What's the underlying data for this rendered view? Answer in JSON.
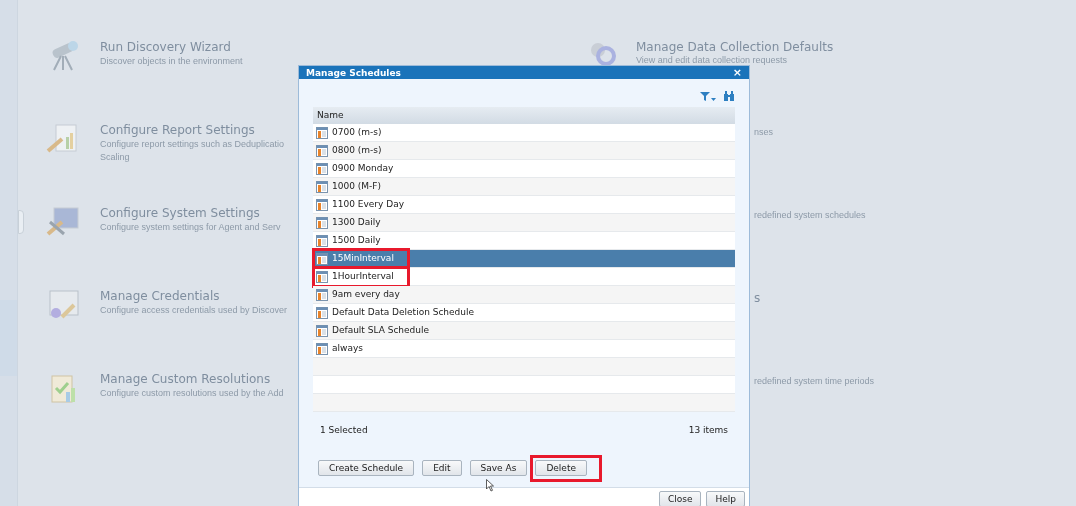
{
  "background": {
    "left_items": [
      {
        "title": "Run Discovery Wizard",
        "lines": [
          "Discover objects in the environment"
        ]
      },
      {
        "title": "Configure Report Settings",
        "lines": [
          "Configure report settings such as Deduplicatio",
          "Scaling"
        ]
      },
      {
        "title": "Configure System Settings",
        "lines": [
          "Configure system settings for Agent and Serv"
        ]
      },
      {
        "title": "Manage Credentials",
        "lines": [
          "Configure access credentials used by Discover"
        ]
      },
      {
        "title": "Manage Custom Resolutions",
        "lines": [
          "Configure custom resolutions used by the Add"
        ]
      }
    ],
    "right_item": {
      "title": "Manage Data Collection Defaults",
      "description": "View and edit data collection requests"
    },
    "right_fragments": [
      {
        "kind": "description",
        "text": "nses"
      },
      {
        "kind": "description",
        "text": "redefined system schedules"
      },
      {
        "kind": "title",
        "text": "s"
      },
      {
        "kind": "description",
        "text": "redefined system time periods"
      }
    ]
  },
  "dialog": {
    "title": "Manage Schedules",
    "close_glyph": "×",
    "table": {
      "columns": [
        "Name"
      ],
      "rows": [
        {
          "name": "0700 (m-s)",
          "selected": false,
          "highlighted": false
        },
        {
          "name": "0800 (m-s)",
          "selected": false,
          "highlighted": false
        },
        {
          "name": "0900 Monday",
          "selected": false,
          "highlighted": false
        },
        {
          "name": "1000 (M-F)",
          "selected": false,
          "highlighted": false
        },
        {
          "name": "1100 Every Day",
          "selected": false,
          "highlighted": false
        },
        {
          "name": "1300 Daily",
          "selected": false,
          "highlighted": false
        },
        {
          "name": "1500 Daily",
          "selected": false,
          "highlighted": false
        },
        {
          "name": "15MinInterval",
          "selected": true,
          "highlighted": true
        },
        {
          "name": "1HourInterval",
          "selected": false,
          "highlighted": true
        },
        {
          "name": "9am every day",
          "selected": false,
          "highlighted": false
        },
        {
          "name": "Default Data Deletion Schedule",
          "selected": false,
          "highlighted": false
        },
        {
          "name": "Default SLA Schedule",
          "selected": false,
          "highlighted": false
        },
        {
          "name": "always",
          "selected": false,
          "highlighted": false
        }
      ]
    },
    "selection_count": "1 Selected",
    "item_count": "13 items",
    "buttons": [
      {
        "label": "Create Schedule",
        "highlighted": false
      },
      {
        "label": "Edit",
        "highlighted": false
      },
      {
        "label": "Save As",
        "highlighted": false
      },
      {
        "label": "Delete",
        "highlighted": true
      }
    ],
    "footer_buttons": [
      "Close",
      "Help"
    ]
  }
}
